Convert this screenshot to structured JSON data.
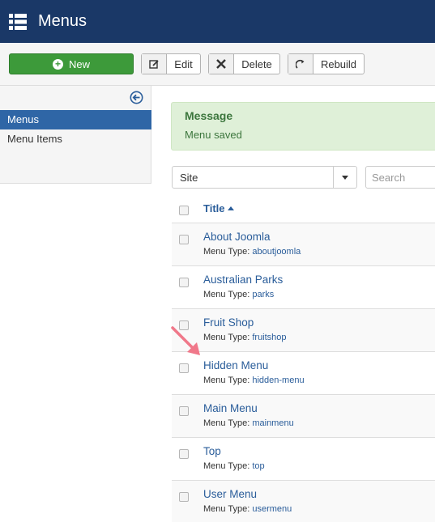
{
  "header": {
    "title": "Menus",
    "icon": "list-icon"
  },
  "toolbar": {
    "new_label": "New",
    "edit_label": "Edit",
    "delete_label": "Delete",
    "rebuild_label": "Rebuild"
  },
  "sidebar": {
    "items": [
      {
        "label": "Menus",
        "active": true
      },
      {
        "label": "Menu Items",
        "active": false
      }
    ]
  },
  "message": {
    "heading": "Message",
    "text": "Menu saved"
  },
  "filters": {
    "site_value": "Site",
    "search_placeholder": "Search"
  },
  "table": {
    "title_header": "Title",
    "type_prefix": "Menu Type:",
    "rows": [
      {
        "title": "About Joomla",
        "menu_type": "aboutjoomla"
      },
      {
        "title": "Australian Parks",
        "menu_type": "parks"
      },
      {
        "title": "Fruit Shop",
        "menu_type": "fruitshop"
      },
      {
        "title": "Hidden Menu",
        "menu_type": "hidden-menu"
      },
      {
        "title": "Main Menu",
        "menu_type": "mainmenu"
      },
      {
        "title": "Top",
        "menu_type": "top"
      },
      {
        "title": "User Menu",
        "menu_type": "usermenu"
      }
    ]
  },
  "colors": {
    "header_bg": "#1a3867",
    "new_button": "#3d9a3a",
    "active_sidebar": "#2f66a6",
    "link": "#2a5d9a",
    "message_bg": "#dff0d8",
    "annotation_arrow": "#f0788a"
  }
}
